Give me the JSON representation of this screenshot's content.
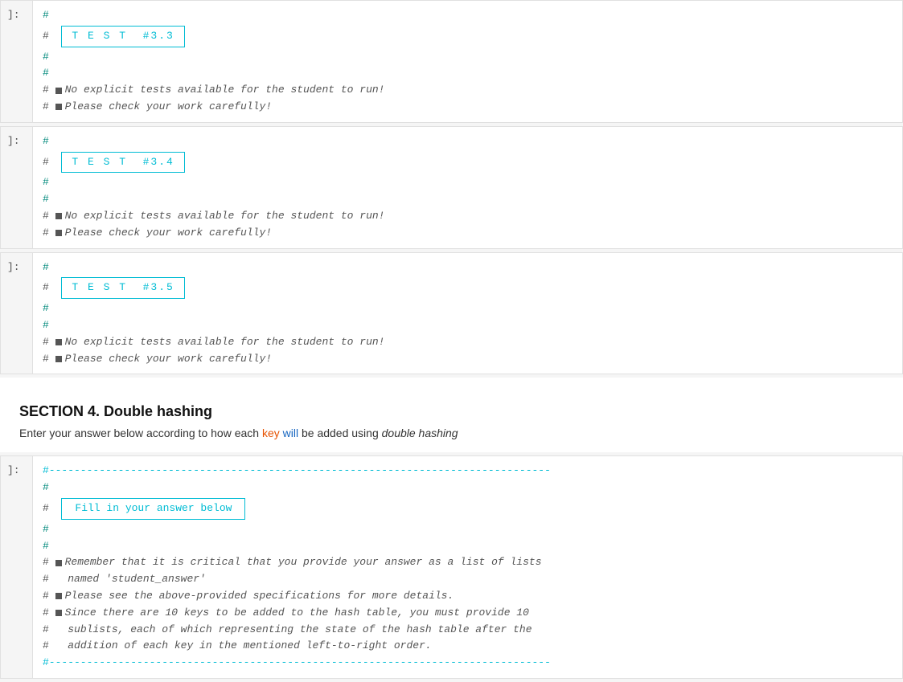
{
  "cells": [
    {
      "id": "cell-test-3-3",
      "label": "]:",
      "lines": [
        {
          "type": "hash",
          "content": "#"
        },
        {
          "type": "test-box",
          "content": "T E S T  #3.3"
        },
        {
          "type": "hash",
          "content": "#"
        },
        {
          "type": "hash",
          "content": "#"
        },
        {
          "type": "bullet-comment",
          "content": "No explicit tests available for the student to run!"
        },
        {
          "type": "bullet-comment",
          "content": "Please check your work carefully!"
        }
      ]
    },
    {
      "id": "cell-test-3-4",
      "label": "]:",
      "lines": [
        {
          "type": "hash",
          "content": "#"
        },
        {
          "type": "test-box",
          "content": "T E S T  #3.4"
        },
        {
          "type": "hash",
          "content": "#"
        },
        {
          "type": "hash",
          "content": "#"
        },
        {
          "type": "bullet-comment",
          "content": "No explicit tests available for the student to run!"
        },
        {
          "type": "bullet-comment",
          "content": "Please check your work carefully!"
        }
      ]
    },
    {
      "id": "cell-test-3-5",
      "label": "]:",
      "lines": [
        {
          "type": "hash",
          "content": "#"
        },
        {
          "type": "test-box",
          "content": "T E S T  #3.5"
        },
        {
          "type": "hash",
          "content": "#"
        },
        {
          "type": "hash",
          "content": "#"
        },
        {
          "type": "bullet-comment",
          "content": "No explicit tests available for the student to run!"
        },
        {
          "type": "bullet-comment",
          "content": "Please check your work carefully!"
        }
      ]
    }
  ],
  "section4": {
    "heading": "SECTION 4. Double hashing",
    "description_parts": [
      {
        "text": "Enter your answer below according to how each "
      },
      {
        "text": "key",
        "highlight": "orange"
      },
      {
        "text": " "
      },
      {
        "text": "will",
        "highlight": "blue"
      },
      {
        "text": " be added using "
      },
      {
        "text": "double hashing",
        "italic": true
      },
      {
        "text": ""
      }
    ]
  },
  "cell_answer": {
    "label": "]:",
    "dashed_line": "#--------------------------------------------------------------------------------",
    "hash1": "#",
    "fill_box_text": "Fill in your answer below",
    "hash2": "#",
    "hash3": "#",
    "bullet1": "Remember that it is critical that you provide your answer as a list of lists",
    "sub1": "   named 'student_answer'",
    "bullet2": "Please see the above-provided specifications for more details.",
    "bullet3": "Since there are 10 keys to be added to the hash table, you must provide 10",
    "sub2": "   sublists, each of which representing the state of the hash table after the",
    "sub3": "   addition of each key in the mentioned left-to-right order.",
    "dashed_line2": "#--------------------------------------------------------------------------------"
  }
}
